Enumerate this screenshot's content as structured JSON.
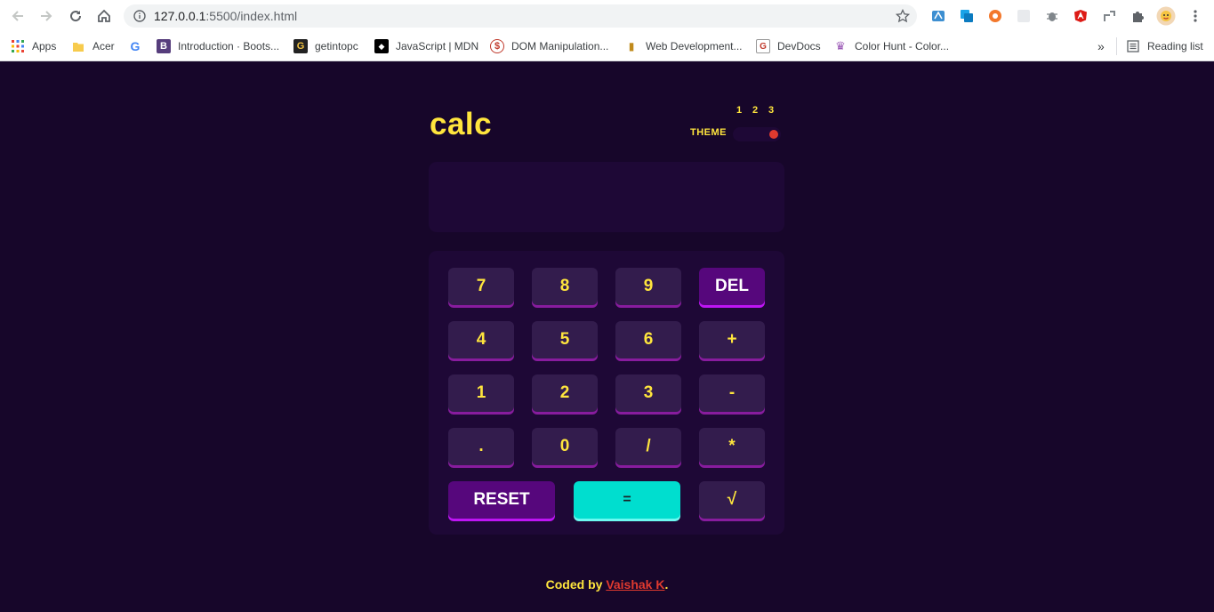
{
  "browser": {
    "url_host": "127.0.0.1",
    "url_rest": ":5500/index.html",
    "bookmarks": [
      {
        "label": "Apps",
        "icon": "apps-grid-icon"
      },
      {
        "label": "Acer",
        "icon": "folder-icon"
      },
      {
        "label": "",
        "icon": "google-icon"
      },
      {
        "label": "Introduction · Boots...",
        "icon": "bootstrap-icon"
      },
      {
        "label": "getintopc",
        "icon": "getintopc-icon"
      },
      {
        "label": "JavaScript | MDN",
        "icon": "mdn-icon"
      },
      {
        "label": "DOM Manipulation...",
        "icon": "dom-icon"
      },
      {
        "label": "Web Development...",
        "icon": "webdev-icon"
      },
      {
        "label": "DevDocs",
        "icon": "devdocs-icon"
      },
      {
        "label": "Color Hunt - Color...",
        "icon": "colorhunt-icon"
      }
    ],
    "more_bookmarks": "»",
    "reading_list": "Reading list"
  },
  "calc": {
    "title": "calc",
    "theme_label": "THEME",
    "theme_numbers": [
      "1",
      "2",
      "3"
    ],
    "theme_selected": 3,
    "display_value": "",
    "keys": [
      [
        "7",
        "8",
        "9",
        "DEL"
      ],
      [
        "4",
        "5",
        "6",
        "+"
      ],
      [
        "1",
        "2",
        "3",
        "-"
      ],
      [
        ".",
        "0",
        "/",
        "*"
      ]
    ],
    "reset_label": "RESET",
    "equals_label": "=",
    "sqrt_label": "√"
  },
  "footer": {
    "prefix": "Coded by ",
    "author": "Vaishak K",
    "suffix": "."
  },
  "colors": {
    "background": "#17062a",
    "panel": "#1e0836",
    "key": "#331c4d",
    "key_shadow": "#881c9e",
    "accent_text": "#ffe53d",
    "del_reset": "#56077c",
    "equals": "#00decf",
    "toggle_knob": "#e03a2f"
  }
}
